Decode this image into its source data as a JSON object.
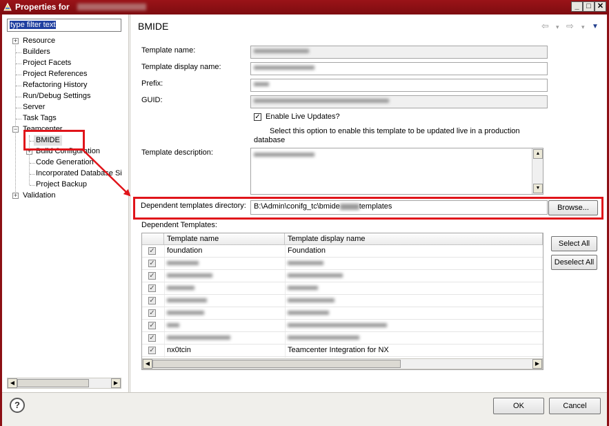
{
  "window": {
    "title": "Properties for",
    "controls": [
      "_",
      "□",
      "✕"
    ]
  },
  "left": {
    "filter_placeholder": "type filter text",
    "tree": [
      {
        "label": "Resource",
        "expander": "+"
      },
      {
        "label": "Builders"
      },
      {
        "label": "Project Facets"
      },
      {
        "label": "Project References"
      },
      {
        "label": "Refactoring History"
      },
      {
        "label": "Run/Debug Settings"
      },
      {
        "label": "Server"
      },
      {
        "label": "Task Tags"
      },
      {
        "label": "Teamcenter",
        "expander": "−"
      },
      {
        "label": "BMIDE"
      },
      {
        "label": "Build Configuration",
        "expander": "+"
      },
      {
        "label": "Code Generation"
      },
      {
        "label": "Incorporated Database Si"
      },
      {
        "label": "Project Backup"
      },
      {
        "label": "Validation",
        "expander": "+"
      }
    ]
  },
  "page": {
    "title": "BMIDE",
    "nav": {
      "back": "⇦",
      "back_menu": "▾",
      "forward": "⇨",
      "forward_menu": "▾",
      "view_menu": "▼"
    },
    "labels": {
      "template_name": "Template name:",
      "template_display_name": "Template display name:",
      "prefix": "Prefix:",
      "guid": "GUID:",
      "template_description": "Template description:",
      "dependent_dir": "Dependent templates directory:",
      "dependent_templates": "Dependent Templates:"
    },
    "prefix_value": "",
    "enable_live_updates": {
      "label": "Enable Live Updates?",
      "checked": true,
      "check_glyph": "✓"
    },
    "live_update_hint": "Select this option to enable this template to be updated live in a production database",
    "dependent_dir_value": {
      "before": "B:\\Admin\\conifg_tc\\bmide",
      "after": "templates"
    },
    "browse_button": "Browse...",
    "select_all_button": "Select All",
    "deselect_all_button": "Deselect All"
  },
  "table": {
    "columns": [
      "Template name",
      "Template display name"
    ],
    "rows": [
      {
        "name": "foundation",
        "display": "Foundation",
        "checked": true
      },
      {
        "name": "",
        "display": "",
        "checked": true
      },
      {
        "name": "",
        "display": "",
        "checked": true
      },
      {
        "name": "",
        "display": "",
        "checked": true
      },
      {
        "name": "",
        "display": "",
        "checked": true
      },
      {
        "name": "",
        "display": "",
        "checked": true
      },
      {
        "name": "",
        "display": "",
        "checked": true
      },
      {
        "name": "",
        "display": "",
        "checked": true
      },
      {
        "name": "nx0tcin",
        "display": "Teamcenter Integration for NX",
        "checked": true
      }
    ],
    "check_glyph": "✓"
  },
  "scroll": {
    "left": "◀",
    "right": "▶",
    "up": "▲",
    "down": "▼"
  },
  "footer": {
    "help": "?",
    "ok": "OK",
    "cancel": "Cancel"
  },
  "colors": {
    "title_bar": "#8c1015",
    "highlight_box": "#e0141a",
    "filter_selection": "#1f3fa0"
  }
}
